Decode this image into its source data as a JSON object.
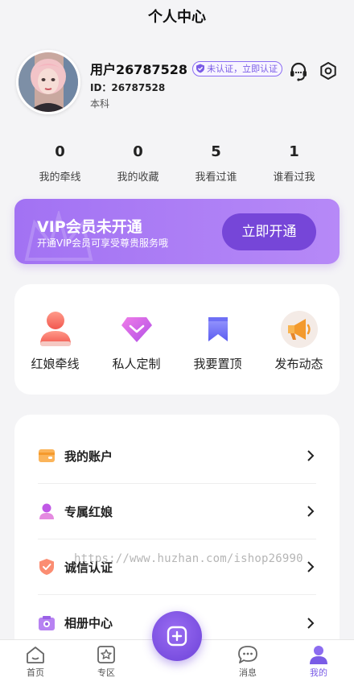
{
  "header": {
    "title": "个人中心"
  },
  "profile": {
    "username": "用户26787528",
    "verify_badge": "未认证，立即认证",
    "id_text": "ID：26787528",
    "education": "本科"
  },
  "stats": [
    {
      "value": "0",
      "label": "我的牵线"
    },
    {
      "value": "0",
      "label": "我的收藏"
    },
    {
      "value": "5",
      "label": "我看过谁"
    },
    {
      "value": "1",
      "label": "谁看过我"
    }
  ],
  "vip": {
    "title": "VIP会员未开通",
    "subtitle": "开通VIP会员可享受尊贵服务哦",
    "button": "立即开通"
  },
  "quick_actions": [
    {
      "label": "红娘牵线",
      "icon": "matchmaker-icon"
    },
    {
      "label": "私人定制",
      "icon": "diamond-icon"
    },
    {
      "label": "我要置顶",
      "icon": "bookmark-icon"
    },
    {
      "label": "发布动态",
      "icon": "megaphone-icon"
    }
  ],
  "menu": [
    {
      "label": "我的账户",
      "icon": "wallet-icon"
    },
    {
      "label": "专属红娘",
      "icon": "person-icon"
    },
    {
      "label": "诚信认证",
      "icon": "shield-check-icon"
    },
    {
      "label": "相册中心",
      "icon": "camera-icon"
    }
  ],
  "watermark": "https://www.huzhan.com/ishop26990",
  "tabbar": [
    {
      "label": "首页",
      "icon": "home-icon"
    },
    {
      "label": "专区",
      "icon": "star-box-icon"
    },
    {
      "label": "消息",
      "icon": "message-icon"
    },
    {
      "label": "我的",
      "icon": "user-icon",
      "active": true
    }
  ],
  "colors": {
    "accent": "#7a5ce6",
    "vip_gradient_start": "#a272f3",
    "vip_button": "#7646d8"
  }
}
